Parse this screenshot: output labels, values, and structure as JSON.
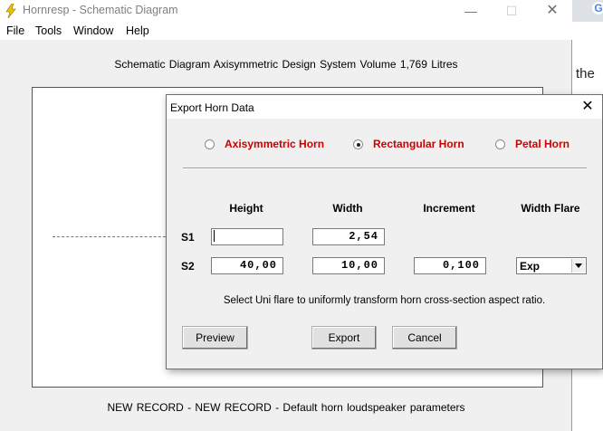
{
  "app": {
    "title": "Hornresp - Schematic Diagram",
    "menu": [
      "File",
      "Tools",
      "Window",
      "Help"
    ],
    "window_controls": {
      "minimize": "—",
      "maximize": "☐",
      "close": "✕"
    }
  },
  "schematic": {
    "caption": "Schematic Diagram   Axisymmetric Design   System Volume 1,769 Litres",
    "footer": "NEW RECORD - NEW RECORD - Default horn loudspeaker parameters"
  },
  "dialog": {
    "title": "Export Horn Data",
    "close": "✕",
    "radios": [
      {
        "label": "Axisymmetric Horn",
        "selected": false
      },
      {
        "label": "Rectangular Horn",
        "selected": true
      },
      {
        "label": "Petal Horn",
        "selected": false
      }
    ],
    "columns": [
      "Height",
      "Width",
      "Increment",
      "Width Flare"
    ],
    "rows": [
      {
        "label": "S1",
        "height": "",
        "width": "2,54"
      },
      {
        "label": "S2",
        "height": "40,00",
        "width": "10,00",
        "increment": "0,100",
        "flare": "Exp"
      }
    ],
    "hint": "Select Uni flare to uniformly transform horn cross-section aspect ratio.",
    "buttons": {
      "preview": "Preview",
      "export": "Export",
      "cancel": "Cancel"
    }
  },
  "background": {
    "browser_text": "the",
    "browser_icon": "G"
  },
  "colors": {
    "radio_label": "#cc0000",
    "dialog_bg": "#f0f0f0"
  }
}
